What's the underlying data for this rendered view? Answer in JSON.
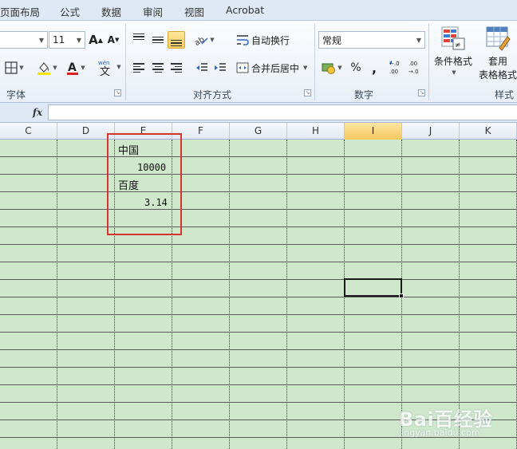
{
  "menu": {
    "tabs": [
      {
        "label": "页面布局"
      },
      {
        "label": "公式"
      },
      {
        "label": "数据"
      },
      {
        "label": "审阅"
      },
      {
        "label": "视图"
      },
      {
        "label": "Acrobat"
      }
    ]
  },
  "ribbon": {
    "font": {
      "size_value": "11",
      "group_label": "字体"
    },
    "alignment": {
      "wrap_text_label": "自动换行",
      "merge_center_label": "合并后居中",
      "group_label": "对齐方式"
    },
    "number": {
      "format_value": "常规",
      "percent_symbol": "%",
      "comma_symbol": ",",
      "group_label": "数字"
    },
    "styles": {
      "conditional_format_label": "条件格式",
      "table_format_label_1": "套用",
      "table_format_label_2": "表格格式",
      "group_label": "样式"
    }
  },
  "formula_bar": {
    "fx_label": "fx",
    "value": ""
  },
  "columns": [
    "C",
    "D",
    "E",
    "F",
    "G",
    "H",
    "I",
    "J",
    "K"
  ],
  "selected_column": "I",
  "cells": {
    "e1": "中国",
    "e2": "10000",
    "e3": "百度",
    "e4": "3.14"
  },
  "watermark": {
    "main": "Bai百经验",
    "sub": "jingyan.baidu.com"
  },
  "colors": {
    "grid_bg": "#cfe8cc",
    "highlight_border": "#d8342f",
    "selected_header": "#f6c75e"
  }
}
